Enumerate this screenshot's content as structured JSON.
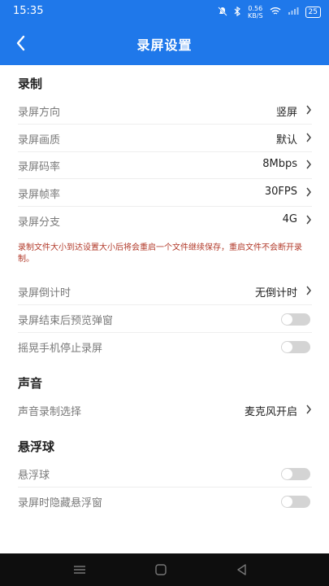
{
  "status": {
    "time": "15:35",
    "net_speed": "0.56",
    "net_unit": "KB/S",
    "battery": "25"
  },
  "header": {
    "title": "录屏设置"
  },
  "sections": {
    "record": "录制",
    "sound": "声音",
    "float": "悬浮球"
  },
  "rows": {
    "direction": {
      "label": "录屏方向",
      "value": "竖屏"
    },
    "quality": {
      "label": "录屏画质",
      "value": "默认"
    },
    "bitrate": {
      "label": "录屏码率",
      "value": "8Mbps"
    },
    "framerate": {
      "label": "录屏帧率",
      "value": "30FPS"
    },
    "split": {
      "label": "录屏分支",
      "value": "4G"
    },
    "countdown": {
      "label": "录屏倒计时",
      "value": "无倒计时"
    },
    "preview_popup": {
      "label": "录屏结束后预览弹窗",
      "enabled": false
    },
    "shake_stop": {
      "label": "摇晃手机停止录屏",
      "enabled": false
    },
    "sound_source": {
      "label": "声音录制选择",
      "value": "麦克风开启"
    },
    "float_ball": {
      "label": "悬浮球",
      "enabled": false
    },
    "hide_float": {
      "label": "录屏时隐藏悬浮窗",
      "enabled": false
    }
  },
  "note": "录制文件大小到达设置大小后将会重启一个文件继续保存，重启文件不会断开录制。",
  "colors": {
    "accent": "#1f78ea",
    "note": "#b23a2a",
    "toggle_off": "#d4d4d4"
  },
  "icons": {
    "back": "chevron-left-icon",
    "chevron": "chevron-right-icon",
    "nav_menu": "menu-icon",
    "nav_home": "square-icon",
    "nav_back": "triangle-back-icon"
  }
}
